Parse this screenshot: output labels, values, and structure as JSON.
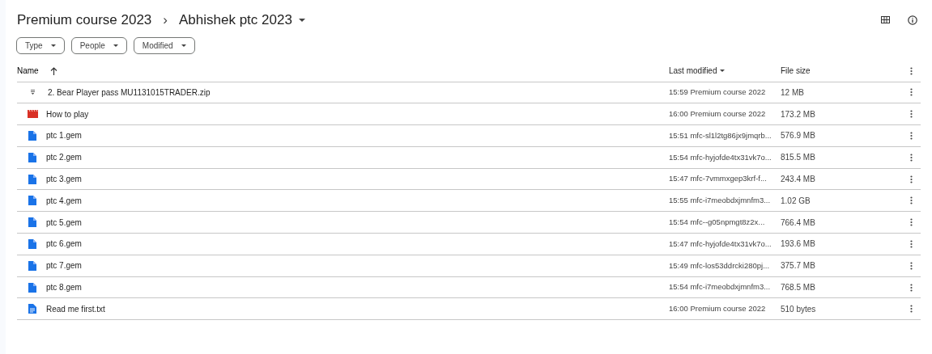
{
  "breadcrumb": {
    "parent": "Premium course 2023",
    "separator": "›",
    "current": "Abhishek ptc 2023"
  },
  "filters": [
    "Type",
    "People",
    "Modified"
  ],
  "table": {
    "columns": {
      "name": "Name",
      "modified": "Last modified",
      "size": "File size"
    },
    "rows": [
      {
        "kind": "zip",
        "name": "2. Bear Player pass MU1131015TRADER.zip",
        "modified": "15:59 Premium course 2022",
        "size": "12 MB"
      },
      {
        "kind": "video",
        "name": "How to play",
        "modified": "16:00 Premium course 2022",
        "size": "173.2 MB"
      },
      {
        "kind": "file",
        "name": "ptc 1.gem",
        "modified": "15:51 mfc-sl1l2tg86jx9jmqrb...",
        "size": "576.9 MB"
      },
      {
        "kind": "file",
        "name": "ptc 2.gem",
        "modified": "15:54 mfc-hyjofde4tx31vk7o...",
        "size": "815.5 MB"
      },
      {
        "kind": "file",
        "name": "ptc 3.gem",
        "modified": "15:47 mfc-7vmmxgep3krf-f...",
        "size": "243.4 MB"
      },
      {
        "kind": "file",
        "name": "ptc 4.gem",
        "modified": "15:55 mfc-i7meobdxjmnfm3...",
        "size": "1.02 GB"
      },
      {
        "kind": "file",
        "name": "ptc 5.gem",
        "modified": "15:54 mfc--g05npmgt8z2x...",
        "size": "766.4 MB"
      },
      {
        "kind": "file",
        "name": "ptc 6.gem",
        "modified": "15:47 mfc-hyjofde4tx31vk7o...",
        "size": "193.6 MB"
      },
      {
        "kind": "file",
        "name": "ptc 7.gem",
        "modified": "15:49 mfc-los53ddrcki280pj...",
        "size": "375.7 MB"
      },
      {
        "kind": "file",
        "name": "ptc 8.gem",
        "modified": "15:54 mfc-i7meobdxjmnfm3...",
        "size": "768.5 MB"
      },
      {
        "kind": "doc",
        "name": "Read me first.txt",
        "modified": "16:00 Premium course 2022",
        "size": "510 bytes"
      }
    ]
  }
}
